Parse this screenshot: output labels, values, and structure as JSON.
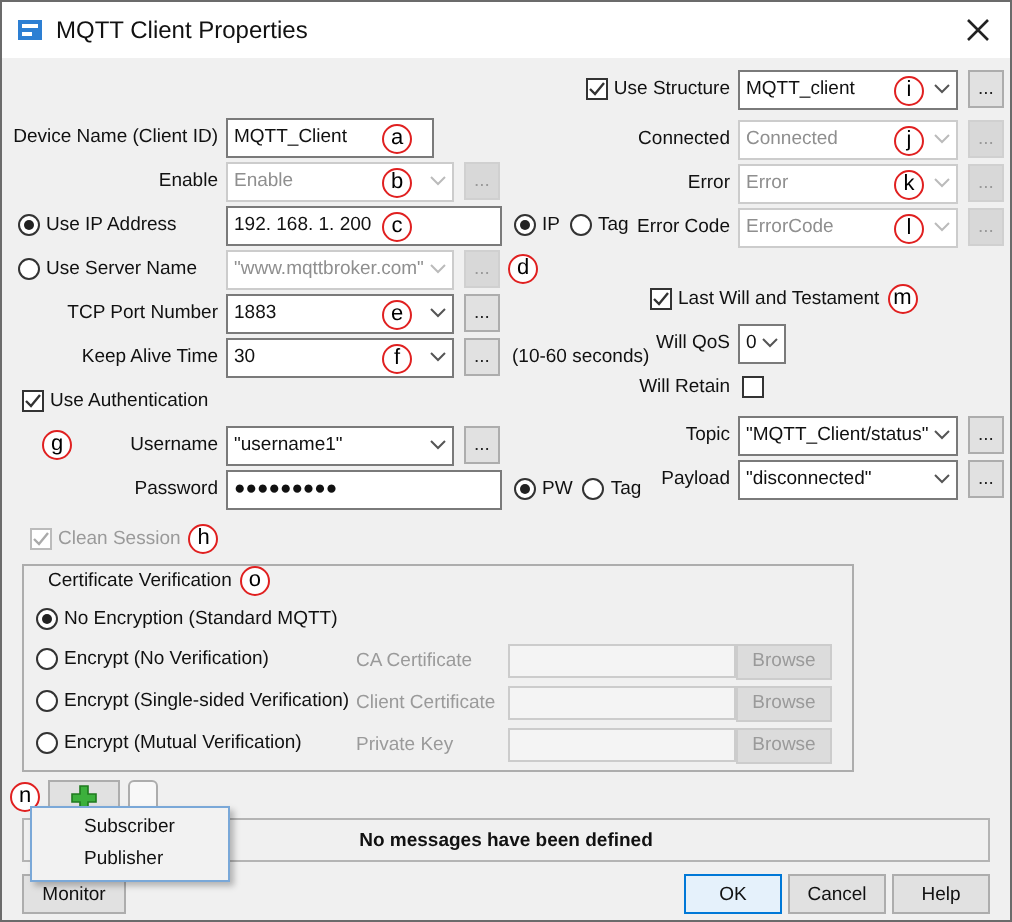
{
  "window": {
    "title": "MQTT Client Properties"
  },
  "left_rows": [
    {
      "kind": "field",
      "label": {
        "kind": "plain",
        "text": "Device Name (Client ID)"
      },
      "value": "MQTT_Client",
      "dropdown": false,
      "disabled": false,
      "marker": "a"
    },
    {
      "kind": "field",
      "label": {
        "kind": "plain",
        "text": "Enable"
      },
      "value": "Enable",
      "dropdown": true,
      "disabled": true,
      "marker": "b",
      "browse": {
        "text": "...",
        "disabled": true
      }
    },
    {
      "kind": "field",
      "label": {
        "kind": "radio",
        "text": "Use IP Address",
        "selected": true
      },
      "value": "192. 168. 1. 200",
      "dropdown": false,
      "disabled": false,
      "marker": "c",
      "options": [
        {
          "label": "IP",
          "selected": true
        },
        {
          "label": "Tag",
          "selected": false
        }
      ]
    },
    {
      "kind": "field",
      "label": {
        "kind": "radio",
        "text": "Use Server Name",
        "selected": false
      },
      "value": "\"www.mqttbroker.com\"",
      "dropdown": true,
      "disabled": true,
      "browse": {
        "text": "...",
        "disabled": true
      },
      "marker_after": "d"
    },
    {
      "kind": "field",
      "label": {
        "kind": "plain",
        "text": "TCP Port Number"
      },
      "value": "1883",
      "dropdown": true,
      "disabled": false,
      "marker": "e",
      "browse": {
        "text": "...",
        "disabled": false
      }
    },
    {
      "kind": "field",
      "label": {
        "kind": "plain",
        "text": "Keep Alive Time"
      },
      "value": "30",
      "dropdown": true,
      "disabled": false,
      "marker": "f",
      "browse": {
        "text": "...",
        "disabled": false
      },
      "note": "(10-60 seconds)"
    },
    {
      "kind": "check",
      "label": "Use Authentication",
      "checked": true,
      "disabled": false
    },
    {
      "kind": "field",
      "label": {
        "kind": "plain",
        "text": "Username"
      },
      "lead_marker": "g",
      "value": "\"username1\"",
      "dropdown": true,
      "disabled": false,
      "browse": {
        "text": "...",
        "disabled": false
      }
    },
    {
      "kind": "field",
      "label": {
        "kind": "plain",
        "text": "Password"
      },
      "value": "●●●●●●●●●",
      "dropdown": false,
      "disabled": false,
      "options": [
        {
          "label": "PW",
          "selected": true
        },
        {
          "label": "Tag",
          "selected": false
        }
      ]
    }
  ],
  "right_rows": [
    {
      "kind": "field",
      "label": {
        "kind": "checkbox",
        "text": "Use Structure",
        "checked": true
      },
      "value": "MQTT_client",
      "dropdown": true,
      "disabled": false,
      "marker": "i",
      "browse": {
        "text": "...",
        "disabled": false
      }
    },
    {
      "kind": "field",
      "label": {
        "kind": "plain",
        "text": "Connected"
      },
      "value": "Connected",
      "dropdown": true,
      "disabled": true,
      "marker": "j",
      "browse": {
        "text": "...",
        "disabled": true
      }
    },
    {
      "kind": "field",
      "label": {
        "kind": "plain",
        "text": "Error"
      },
      "value": "Error",
      "dropdown": true,
      "disabled": true,
      "marker": "k",
      "browse": {
        "text": "...",
        "disabled": true
      }
    },
    {
      "kind": "field",
      "label": {
        "kind": "plain",
        "text": "Error Code"
      },
      "value": "ErrorCode",
      "dropdown": true,
      "disabled": true,
      "marker": "l",
      "browse": {
        "text": "...",
        "disabled": true
      }
    },
    {
      "kind": "check",
      "label": "Last Will and Testament",
      "checked": true,
      "disabled": false,
      "marker_after": "m"
    },
    {
      "kind": "small",
      "label": "Will QoS",
      "value": "0",
      "dropdown": true,
      "disabled": false
    },
    {
      "kind": "check_after",
      "label": "Will Retain",
      "checked": false
    },
    {
      "kind": "field",
      "label": {
        "kind": "plain",
        "text": "Topic"
      },
      "value": "\"MQTT_Client/status\"",
      "dropdown": true,
      "disabled": false,
      "browse": {
        "text": "...",
        "disabled": false
      }
    },
    {
      "kind": "field",
      "label": {
        "kind": "plain",
        "text": "Payload"
      },
      "value": "\"disconnected\"",
      "dropdown": true,
      "disabled": false,
      "browse": {
        "text": "...",
        "disabled": false
      }
    }
  ],
  "clean_session": {
    "label": "Clean Session",
    "checked": true,
    "disabled": true,
    "marker": "h"
  },
  "certificate": {
    "title": "Certificate Verification",
    "marker": "o",
    "options": [
      {
        "label": "No Encryption (Standard MQTT)",
        "selected": true
      },
      {
        "label": "Encrypt (No Verification)",
        "selected": false,
        "file_label": "CA Certificate",
        "browse": "Browse",
        "disabled": true
      },
      {
        "label": "Encrypt (Single-sided Verification)",
        "selected": false,
        "file_label": "Client Certificate",
        "browse": "Browse",
        "disabled": true
      },
      {
        "label": "Encrypt (Mutual Verification)",
        "selected": false,
        "file_label": "Private Key",
        "browse": "Browse",
        "disabled": true
      }
    ]
  },
  "toolbar": {
    "marker": "n",
    "buttons": [
      {
        "kind": "add"
      },
      {
        "kind": "blank"
      }
    ]
  },
  "messages": {
    "text": "No messages have been defined"
  },
  "menu": {
    "items": [
      "Subscriber",
      "Publisher"
    ]
  },
  "footer": {
    "monitor": "Monitor",
    "buttons": [
      {
        "label": "OK",
        "default": true
      },
      {
        "label": "Cancel",
        "default": false
      },
      {
        "label": "Help",
        "default": false
      }
    ]
  }
}
